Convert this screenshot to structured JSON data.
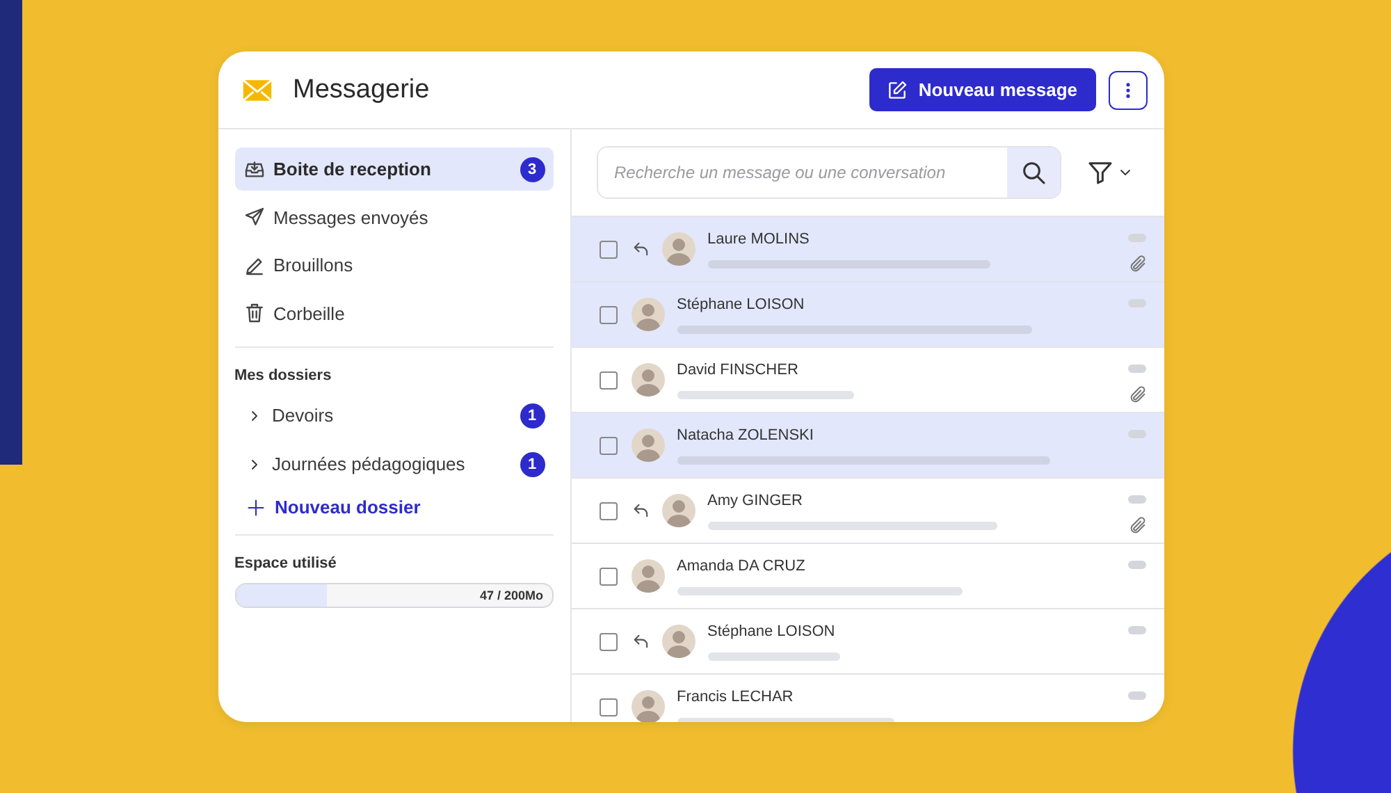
{
  "header": {
    "title": "Messagerie",
    "new_message_button": "Nouveau message"
  },
  "sidebar": {
    "items": [
      {
        "kind": "inbox",
        "label": "Boite de reception",
        "badge": "3",
        "selected": true
      },
      {
        "kind": "sent",
        "label": "Messages envoyés",
        "selected": false
      },
      {
        "kind": "drafts",
        "label": "Brouillons",
        "selected": false
      },
      {
        "kind": "trash",
        "label": "Corbeille",
        "selected": false
      }
    ],
    "folders_heading": "Mes dossiers",
    "folders": [
      {
        "label": "Devoirs",
        "badge": "1",
        "expanded": false
      },
      {
        "label": "Journées pédagogiques",
        "badge": "1",
        "expanded": false
      }
    ],
    "new_folder": "Nouveau dossier",
    "storage": {
      "label": "Espace utilisé",
      "reading": "47 / 200Mo",
      "level": 0.29
    }
  },
  "search": {
    "placeholder": "Recherche un message ou une conversation"
  },
  "messages": [
    {
      "sender": "Laure MOLINS",
      "unread": true,
      "replied": true,
      "attachment": true,
      "checked": false
    },
    {
      "sender": "Stéphane LOISON",
      "unread": true,
      "replied": false,
      "attachment": false,
      "checked": false
    },
    {
      "sender": "David FINSCHER",
      "unread": false,
      "replied": false,
      "attachment": true,
      "checked": false
    },
    {
      "sender": "Natacha ZOLENSKI",
      "unread": true,
      "replied": false,
      "attachment": false,
      "checked": false
    },
    {
      "sender": "Amy GINGER",
      "unread": false,
      "replied": true,
      "attachment": true,
      "checked": false
    },
    {
      "sender": "Amanda DA CRUZ",
      "unread": false,
      "replied": false,
      "attachment": false,
      "checked": false
    },
    {
      "sender": "Stéphane LOISON",
      "unread": false,
      "replied": true,
      "attachment": false,
      "checked": false
    },
    {
      "sender": "Francis LECHAR",
      "unread": false,
      "replied": false,
      "attachment": false,
      "checked": false
    }
  ]
}
